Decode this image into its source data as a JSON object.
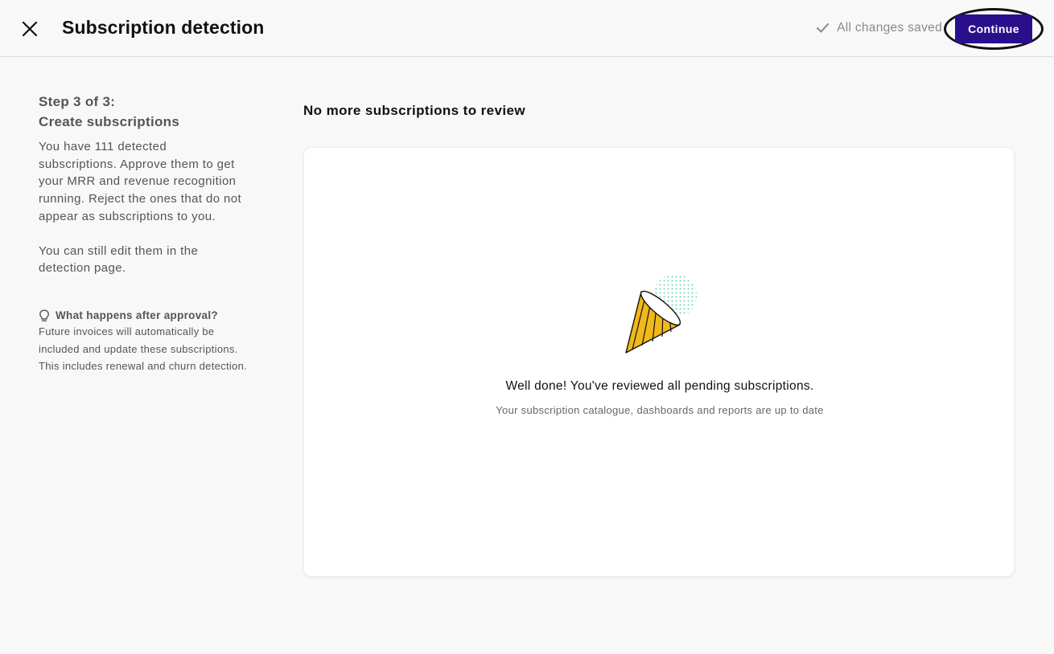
{
  "header": {
    "title": "Subscription detection",
    "saved_status": "All changes saved",
    "continue_label": "Continue"
  },
  "sidebar": {
    "step_line1": "Step 3 of 3:",
    "step_line2": "Create subscriptions",
    "description": "You have 111 detected subscriptions. Approve them to get your MRR and revenue recognition running. Reject the ones that do not appear as subscriptions to you.",
    "description2": "You can still edit them in the detection page.",
    "approval_heading": "What happens after approval?",
    "approval_body": "Future invoices will automatically be included and update these subscriptions. This includes renewal and churn detection."
  },
  "main": {
    "heading": "No more subscriptions to review",
    "empty_title": "Well done! You've reviewed all pending subscriptions.",
    "empty_subtitle": "Your subscription catalogue, dashboards and reports are up to date"
  },
  "colors": {
    "accent": "#2a0f8c",
    "party_hat": "#f1b81c",
    "confetti": "#6fd3b8"
  },
  "icons": {
    "close": "close-icon",
    "check": "check-icon",
    "lightbulb": "lightbulb-icon",
    "party": "party-hat-icon"
  }
}
